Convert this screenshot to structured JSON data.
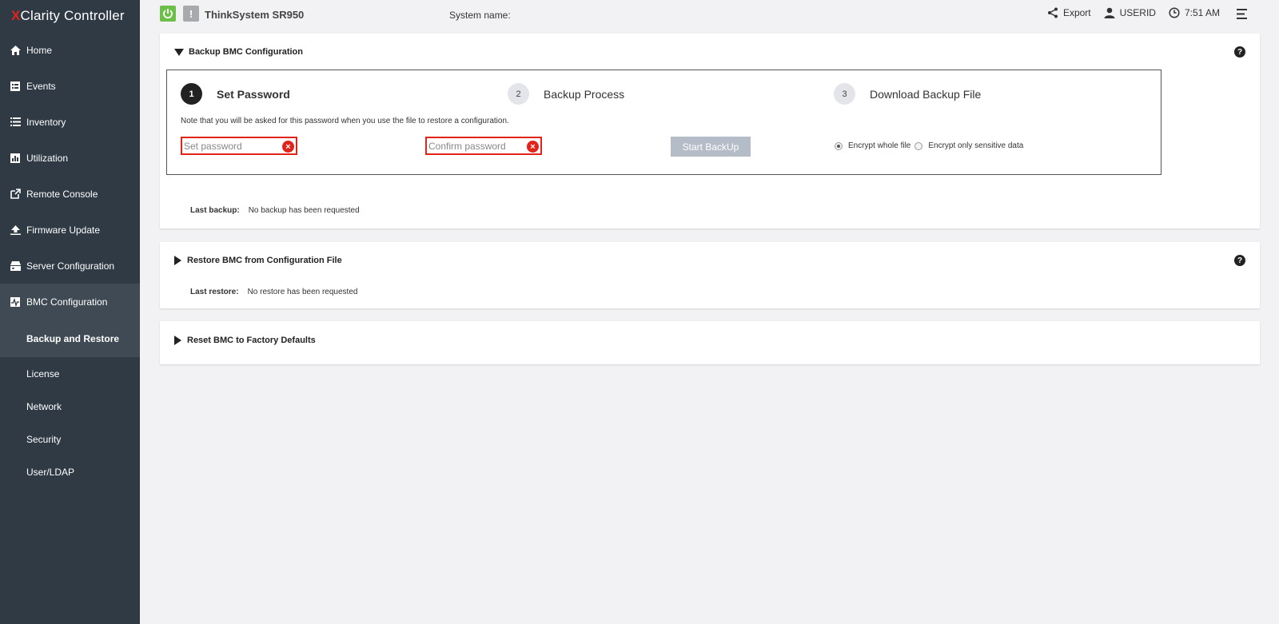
{
  "sidebar": {
    "logo_mark": "X",
    "logo_rest": "Clarity Controller",
    "items": [
      {
        "label": "Home",
        "icon": "home-icon"
      },
      {
        "label": "Events",
        "icon": "events-icon"
      },
      {
        "label": "Inventory",
        "icon": "list-icon"
      },
      {
        "label": "Utilization",
        "icon": "chart-icon"
      },
      {
        "label": "Remote Console",
        "icon": "external-link-icon"
      },
      {
        "label": "Firmware Update",
        "icon": "upload-icon"
      },
      {
        "label": "Server Configuration",
        "icon": "server-icon"
      },
      {
        "label": "BMC Configuration",
        "icon": "bmc-icon"
      }
    ],
    "sub_items": [
      {
        "label": "Backup and Restore"
      },
      {
        "label": "License"
      },
      {
        "label": "Network"
      },
      {
        "label": "Security"
      },
      {
        "label": "User/LDAP"
      }
    ]
  },
  "topbar": {
    "alert_glyph": "!",
    "product": "ThinkSystem SR950",
    "system_name_label": "System name:",
    "export_label": "Export",
    "user_label": "USERID",
    "time": "7:51 AM"
  },
  "backup": {
    "title": "Backup BMC Configuration",
    "help": "?",
    "steps": [
      {
        "num": "1",
        "label": "Set Password"
      },
      {
        "num": "2",
        "label": "Backup Process"
      },
      {
        "num": "3",
        "label": "Download Backup File"
      }
    ],
    "note": "Note that you will be asked for this password when you use the file to restore a configuration.",
    "password_placeholder": "Set password",
    "confirm_placeholder": "Confirm password",
    "error_glyph": "×",
    "start_button": "Start BackUp",
    "radio_whole": "Encrypt whole file",
    "radio_sensitive": "Encrypt only sensitive data",
    "last_backup_label": "Last backup:",
    "last_backup_value": "No backup has been requested"
  },
  "restore": {
    "title": "Restore BMC from Configuration File",
    "help": "?",
    "last_restore_label": "Last restore:",
    "last_restore_value": "No restore has been requested"
  },
  "reset": {
    "title": "Reset BMC to Factory Defaults"
  },
  "colors": {
    "sidebar_bg": "#2f3a45",
    "accent_red": "#e2231a",
    "power_green": "#6cc04a"
  }
}
